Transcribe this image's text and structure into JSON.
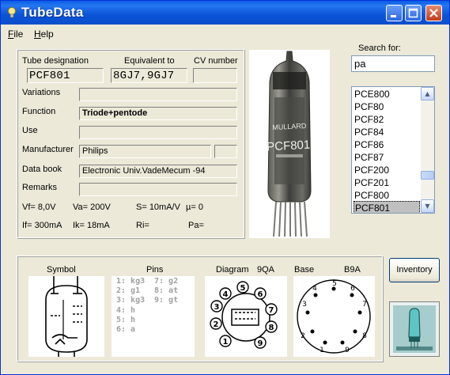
{
  "window": {
    "title": "TubeData"
  },
  "menu": [
    {
      "label_u": "F",
      "label_rest": "ile"
    },
    {
      "label_u": "H",
      "label_rest": "elp"
    }
  ],
  "details": {
    "tube_designation_label": "Tube designation",
    "tube_designation": "PCF801",
    "equivalent_label": "Equivalent to",
    "equivalent": "8GJ7,9GJ7",
    "cv_label": "CV number",
    "cv": "",
    "variations_label": "Variations",
    "variations": "",
    "function_label": "Function",
    "function": "Triode+pentode",
    "use_label": "Use",
    "use": "",
    "manufacturer_label": "Manufacturer",
    "manufacturer": "Philips",
    "manufacturer_code": "",
    "databook_label": "Data book",
    "databook": "Electronic Univ.VadeMecum -94",
    "remarks_label": "Remarks",
    "remarks": "",
    "vf": "Vf= 8,0V",
    "va": "Va= 200V",
    "s": "S= 10mA/V",
    "mu": "µ=   0",
    "if": "If= 300mA",
    "ik": "Ik=  18mA",
    "ri": "Ri=",
    "pa": "Pa="
  },
  "search": {
    "label": "Search for:",
    "value": "pa"
  },
  "list": {
    "items": [
      "PCE800",
      "PCF80",
      "PCF82",
      "PCF84",
      "PCF86",
      "PCF87",
      "PCF200",
      "PCF201",
      "PCF800",
      "PCF801"
    ],
    "selected": "PCF801"
  },
  "bottom": {
    "symbol_label": "Symbol",
    "pins_label": "Pins",
    "diagram_label": "Diagram",
    "diagram_code": "9QA",
    "base_label": "Base",
    "base_code": "B9A",
    "pins_col1": [
      "1: kg3",
      "2: g1",
      "3: kg3",
      "4: h",
      "5: h",
      "6: a"
    ],
    "pins_col2": [
      "7: g2",
      "8: at",
      "9: gt"
    ]
  },
  "inventory_button": "Inventory",
  "photo_text": {
    "brand": "MULLARD",
    "model": "PCF801"
  },
  "colors": {
    "title_bar": "#0b54d8",
    "face": "#ece9d8",
    "close": "#c43b1a"
  },
  "icons": [
    "lightbulb-icon",
    "minimize-icon",
    "maximize-icon",
    "close-icon",
    "scroll-up-icon",
    "scroll-down-icon"
  ]
}
